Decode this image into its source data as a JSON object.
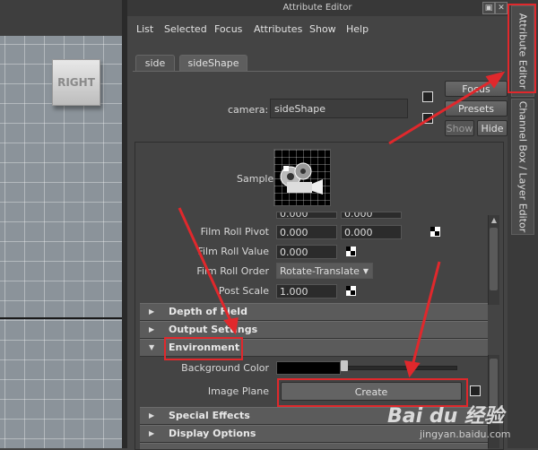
{
  "viewport": {
    "cube_label": "RIGHT"
  },
  "window": {
    "title": "Attribute Editor"
  },
  "menu": [
    "List",
    "Selected",
    "Focus",
    "Attributes",
    "Show",
    "Help"
  ],
  "tabs": [
    {
      "label": "side",
      "active": false
    },
    {
      "label": "sideShape",
      "active": true
    }
  ],
  "node": {
    "label": "camera:",
    "value": "sideShape"
  },
  "buttons": {
    "focus": "Focus",
    "presets": "Presets",
    "show": "Show",
    "hide": "Hide"
  },
  "sample": {
    "label": "Sample"
  },
  "film_rows": [
    {
      "label": "Film Roll Pivot",
      "values": [
        "0.000",
        "0.000"
      ]
    },
    {
      "label": "Film Roll Value",
      "values": [
        "0.000"
      ]
    },
    {
      "label": "Film Roll Order",
      "dropdown": "Rotate-Translate"
    },
    {
      "label": "Post Scale",
      "values": [
        "1.000"
      ]
    }
  ],
  "partial_row_values": [
    "0.000",
    "0.000"
  ],
  "sections": {
    "depth_of_field": "Depth of Field",
    "output_settings": "Output Settings",
    "environment": "Environment",
    "special_effects": "Special Effects",
    "display_options": "Display Options"
  },
  "environment": {
    "bg_label": "Background Color",
    "bg_color": "#000000",
    "image_plane_label": "Image Plane",
    "create_button": "Create"
  },
  "dock_tabs": [
    "Attribute Editor",
    "Channel Box / Layer Editor"
  ],
  "annotation_color": "#e0282c",
  "watermark": {
    "logo": "Bai du 经验",
    "url": "jingyan.baidu.com"
  }
}
